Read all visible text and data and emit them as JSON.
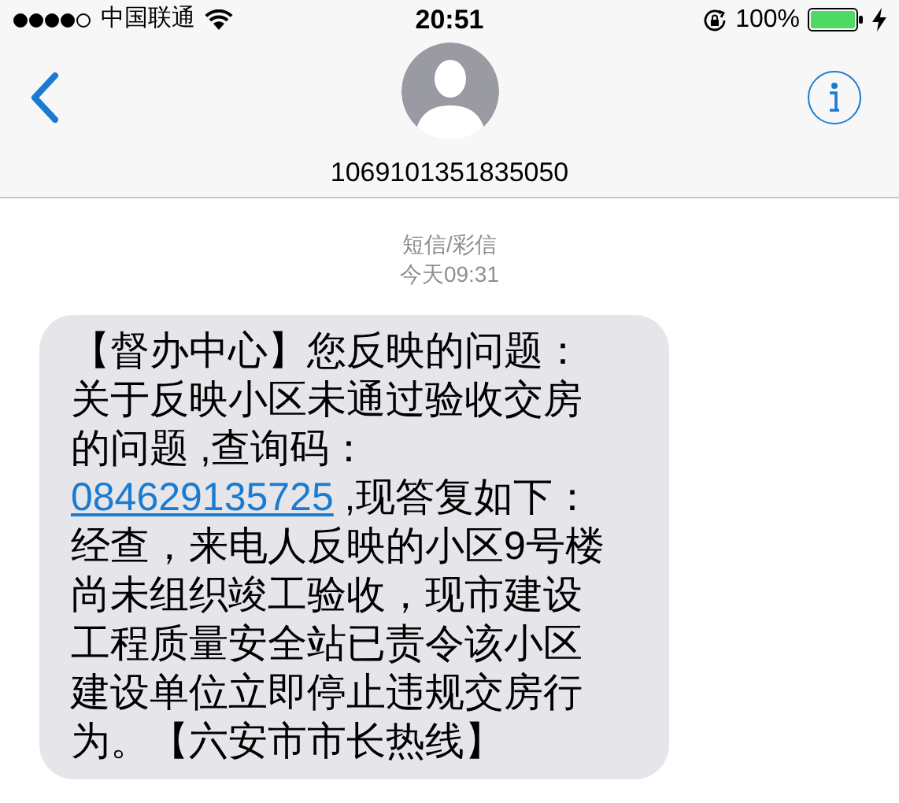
{
  "status_bar": {
    "carrier": "中国联通",
    "time": "20:51",
    "battery": "100%"
  },
  "nav": {
    "contact": "1069101351835050"
  },
  "thread": {
    "service": "短信/彩信",
    "timestamp": "今天09:31"
  },
  "message": {
    "lines": [
      [
        {
          "kind": "text",
          "text": "【督办中心】您反映的问题："
        }
      ],
      [
        {
          "kind": "text",
          "text": "关于反映小区未通过验收交房"
        }
      ],
      [
        {
          "kind": "text",
          "text": "的问题 ,查询码："
        }
      ],
      [
        {
          "kind": "link",
          "text": "084629135725"
        },
        {
          "kind": "text",
          "text": " ,现答复如下："
        }
      ],
      [
        {
          "kind": "text",
          "text": "经查，来电人反映的小区9号楼"
        }
      ],
      [
        {
          "kind": "text",
          "text": "尚未组织竣工验收，现市建设"
        }
      ],
      [
        {
          "kind": "text",
          "text": "工程质量安全站已责令该小区"
        }
      ],
      [
        {
          "kind": "text",
          "text": "建设单位立即停止违规交房行"
        }
      ],
      [
        {
          "kind": "text",
          "text": "为。【六安市市长热线】"
        }
      ]
    ]
  }
}
